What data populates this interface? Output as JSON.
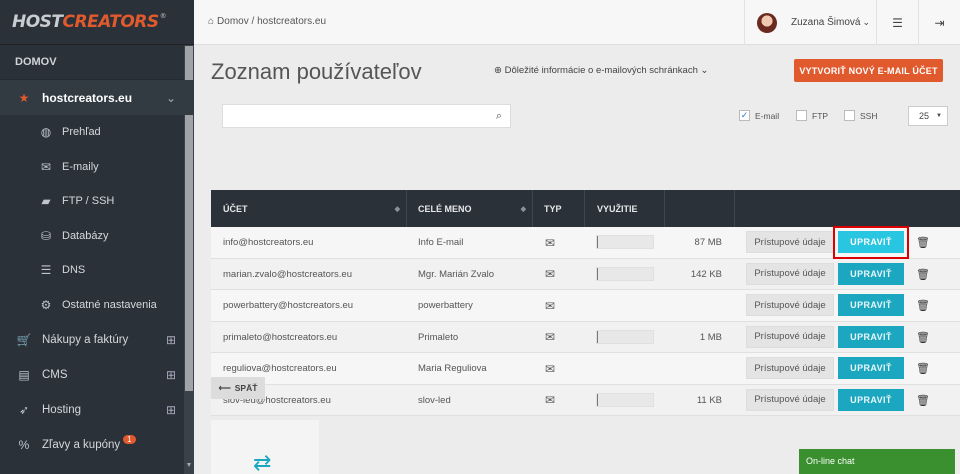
{
  "logo": {
    "part1": "HOST",
    "part2": "CREATORS",
    "reg": "®"
  },
  "sidebar": {
    "heading": "DOMOV",
    "domain": "hostcreators.eu",
    "sub_items": [
      {
        "label": "Prehľad",
        "icon": "globe-icon"
      },
      {
        "label": "E-maily",
        "icon": "envelope-icon"
      },
      {
        "label": "FTP / SSH",
        "icon": "folder-icon"
      },
      {
        "label": "Databázy",
        "icon": "database-icon"
      },
      {
        "label": "DNS",
        "icon": "server-icon"
      },
      {
        "label": "Ostatné nastavenia",
        "icon": "gear-icon"
      }
    ],
    "items": [
      {
        "label": "Nákupy a faktúry",
        "icon": "cart-icon"
      },
      {
        "label": "CMS",
        "icon": "file-icon"
      },
      {
        "label": "Hosting",
        "icon": "rocket-icon"
      },
      {
        "label": "Zľavy a kupóny",
        "icon": "percent-icon",
        "badge": "1"
      }
    ]
  },
  "topbar": {
    "breadcrumb_home": "Domov",
    "breadcrumb_sep": "/",
    "breadcrumb_current": "hostcreators.eu",
    "user_name": "Zuzana Šimová"
  },
  "main": {
    "title": "Zoznam používateľov",
    "info_link": "Dôležité informácie o e-mailových schránkach",
    "new_button": "VYTVORIŤ NOVÝ E-MAIL ÚČET",
    "search_placeholder": "",
    "filters": [
      {
        "label": "E-mail",
        "checked": true
      },
      {
        "label": "FTP",
        "checked": false
      },
      {
        "label": "SSH",
        "checked": false
      }
    ],
    "per_page": "25",
    "columns": {
      "account": "ÚČET",
      "name": "CELÉ MENO",
      "type": "TYP",
      "usage": "VYUŽITIE"
    },
    "access_label": "Prístupové údaje",
    "edit_label": "UPRAVIŤ",
    "rows": [
      {
        "account": "info@hostcreators.eu",
        "name": "Info E-mail",
        "usage": "87 MB",
        "fill": 0.02
      },
      {
        "account": "marian.zvalo@hostcreators.eu",
        "name": "Mgr. Marián Zvalo",
        "usage": "142 KB",
        "fill": 0.0
      },
      {
        "account": "powerbattery@hostcreators.eu",
        "name": "powerbattery",
        "usage": "",
        "fill": null
      },
      {
        "account": "primaleto@hostcreators.eu",
        "name": "Primaleto",
        "usage": "1 MB",
        "fill": 0.0
      },
      {
        "account": "reguliova@hostcreators.eu",
        "name": "Maria Reguliova",
        "usage": "",
        "fill": null
      },
      {
        "account": "slov-led@hostcreators.eu",
        "name": "slov-led",
        "usage": "11 KB",
        "fill": 0.0
      }
    ],
    "back_label": "SPÄŤ"
  },
  "chat": {
    "label": "On-line chat"
  }
}
